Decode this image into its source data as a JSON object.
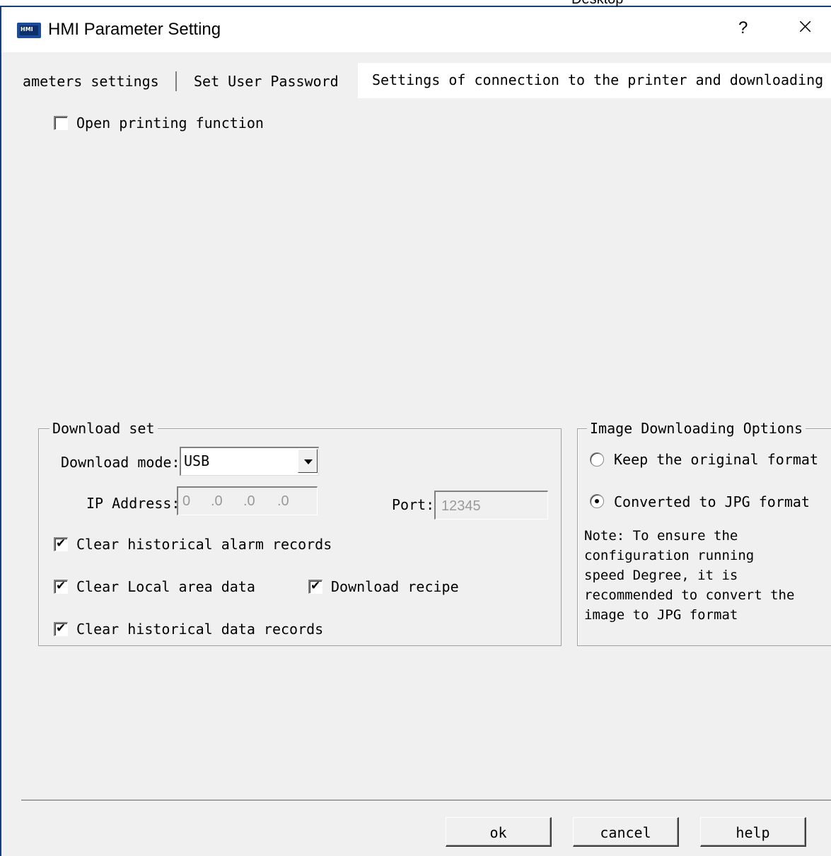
{
  "window": {
    "top_strip_text": "Desktop",
    "title": "HMI Parameter Setting",
    "icon_label": "HMI",
    "help_glyph": "?",
    "close_glyph": "×"
  },
  "tabs": [
    {
      "label": "rameters settings"
    },
    {
      "label": "Set User Password"
    },
    {
      "label": "Settings of connection to the printer and downloading"
    }
  ],
  "printing": {
    "open_printing_label": "Open printing function",
    "open_printing_checked": false
  },
  "download_set": {
    "title": "Download set",
    "mode_label": "Download mode:",
    "mode_value": "USB",
    "ip_label": "IP Address:",
    "ip_octets": [
      "0",
      ".0",
      ".0",
      ".0"
    ],
    "port_label": "Port:",
    "port_value": "12345",
    "clear_alarm_label": "Clear historical alarm records",
    "clear_local_label": "Clear Local  area data",
    "download_recipe_label": "Download recipe",
    "clear_data_label": "Clear historical data records"
  },
  "image_options": {
    "title": "Image Downloading Options",
    "keep_label": "Keep the original format",
    "convert_label": "Converted to JPG format",
    "selected": "convert",
    "note": "Note: To ensure the\nconfiguration running\nspeed Degree, it is\nrecommended to convert the\nimage to JPG format"
  },
  "buttons": {
    "ok": "ok",
    "cancel": "cancel",
    "help": "help"
  }
}
